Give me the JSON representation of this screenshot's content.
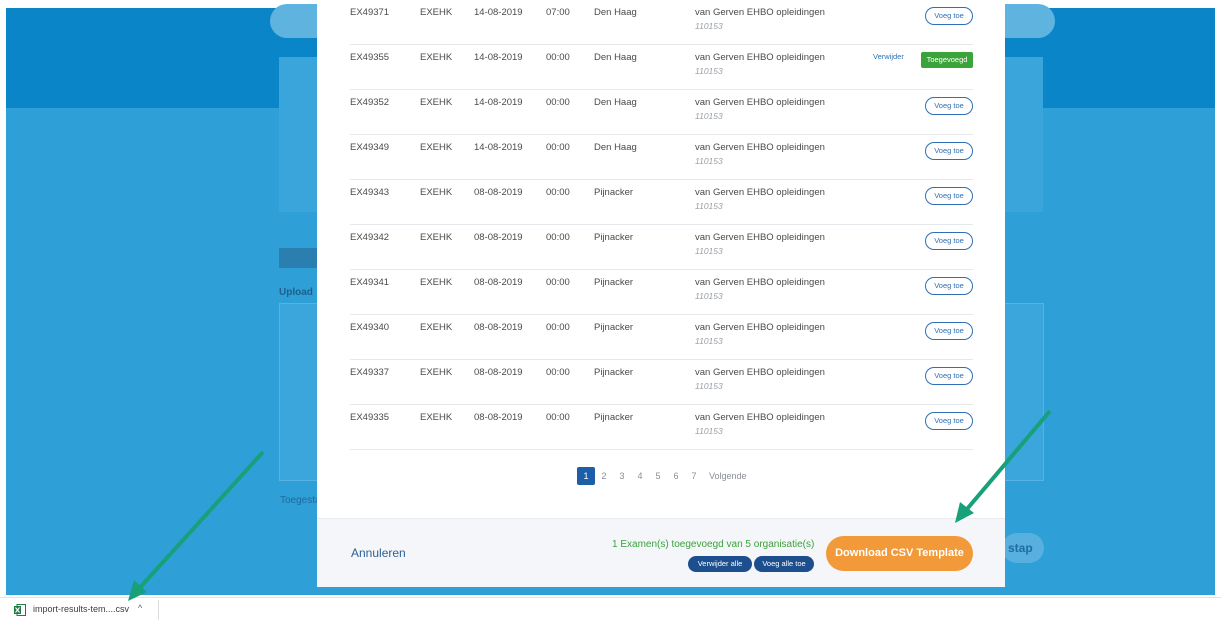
{
  "background": {
    "upload_label": "Upload",
    "allowed_label": "Toegesta",
    "next_step_label": "stap"
  },
  "exams": [
    {
      "id": "EX49371",
      "type": "EXEHK",
      "date": "14-08-2019",
      "time": "07:00",
      "place": "Den Haag",
      "org": "van Gerven EHBO opleidingen",
      "code": "110153",
      "added": false
    },
    {
      "id": "EX49355",
      "type": "EXEHK",
      "date": "14-08-2019",
      "time": "00:00",
      "place": "Den Haag",
      "org": "van Gerven EHBO opleidingen",
      "code": "110153",
      "added": true
    },
    {
      "id": "EX49352",
      "type": "EXEHK",
      "date": "14-08-2019",
      "time": "00:00",
      "place": "Den Haag",
      "org": "van Gerven EHBO opleidingen",
      "code": "110153",
      "added": false
    },
    {
      "id": "EX49349",
      "type": "EXEHK",
      "date": "14-08-2019",
      "time": "00:00",
      "place": "Den Haag",
      "org": "van Gerven EHBO opleidingen",
      "code": "110153",
      "added": false
    },
    {
      "id": "EX49343",
      "type": "EXEHK",
      "date": "08-08-2019",
      "time": "00:00",
      "place": "Pijnacker",
      "org": "van Gerven EHBO opleidingen",
      "code": "110153",
      "added": false
    },
    {
      "id": "EX49342",
      "type": "EXEHK",
      "date": "08-08-2019",
      "time": "00:00",
      "place": "Pijnacker",
      "org": "van Gerven EHBO opleidingen",
      "code": "110153",
      "added": false
    },
    {
      "id": "EX49341",
      "type": "EXEHK",
      "date": "08-08-2019",
      "time": "00:00",
      "place": "Pijnacker",
      "org": "van Gerven EHBO opleidingen",
      "code": "110153",
      "added": false
    },
    {
      "id": "EX49340",
      "type": "EXEHK",
      "date": "08-08-2019",
      "time": "00:00",
      "place": "Pijnacker",
      "org": "van Gerven EHBO opleidingen",
      "code": "110153",
      "added": false
    },
    {
      "id": "EX49337",
      "type": "EXEHK",
      "date": "08-08-2019",
      "time": "00:00",
      "place": "Pijnacker",
      "org": "van Gerven EHBO opleidingen",
      "code": "110153",
      "added": false
    },
    {
      "id": "EX49335",
      "type": "EXEHK",
      "date": "08-08-2019",
      "time": "00:00",
      "place": "Pijnacker",
      "org": "van Gerven EHBO opleidingen",
      "code": "110153",
      "added": false
    }
  ],
  "labels": {
    "add": "Voeg toe",
    "added": "Toegevoegd",
    "remove": "Verwijder"
  },
  "pagination": {
    "pages": [
      "1",
      "2",
      "3",
      "4",
      "5",
      "6",
      "7"
    ],
    "current": "1",
    "next_label": "Volgende"
  },
  "footer": {
    "cancel_label": "Annuleren",
    "status_text": "1 Examen(s) toegevoegd van 5 organisatie(s)",
    "remove_all_label": "Verwijder alle",
    "add_all_label": "Voeg alle toe",
    "download_label": "Download CSV Template"
  },
  "download_bar": {
    "file_name": "import-results-tem....csv",
    "icon": "excel-file-icon",
    "caret": "^"
  },
  "colors": {
    "primary_blue": "#1d4f8e",
    "success_green": "#3aa33a",
    "download_orange": "#f29a3a",
    "annotation_green": "#17a07a"
  }
}
